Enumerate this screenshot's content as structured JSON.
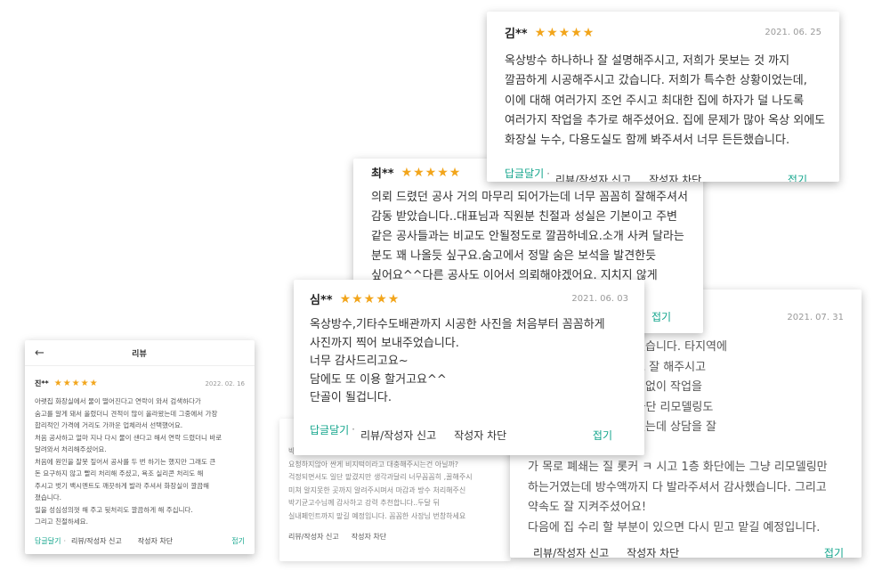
{
  "panel": {
    "title": "리뷰",
    "back_icon": "arrow-left-icon",
    "review": {
      "author": "진**",
      "stars": "★★★★★",
      "date": "2022. 02. 16",
      "lines": [
        "아랫집 화장실에서 물이 떨어진다고 연락이 와서 검색하다가",
        "숨고를 알게 돼서 올렸더니 견적이 많이 올라왔는데 그중에서 가장",
        "합리적인 가격에 거리도 가까운 업체라서 선택했어요.",
        "처음 공사하고 얼마 지나 다시 물이 샌다고 해서 연락 드렸더니 바로",
        "달려와서 처리해주셨어요.",
        "처음에 원인을 잘못 짚어서 공사를 두 번 하기는 했지만 그래도 큰",
        "돈 요구하지 않고 빨리 처리해 주셨고, 욕조 실리콘 처리도 해",
        "주시고 벗기 백시멘트도 깨끗하게 발라 주셔서 화장실이 깔끔해",
        "졌습니다.",
        "일을 성심성의껏 해 주고 뒷처리도 깔끔하게 해 주십니다.",
        "그리고 친절하세요."
      ],
      "reply": "답글달기",
      "report": "리뷰/작성자 신고",
      "block": "작성자 차단",
      "fold": "접기"
    }
  },
  "faded_card": {
    "lines": [
      "박기균고수님께 견적상담을 하였고 생각보다 꼼꼼하게 많이",
      "요청하지않아 싼게 비지떡이라고 대충해주시는건 아닐까?",
      "걱정되면서도 일단 맡겼지만  생각과달리 너무꼼꼼히 ,꿀해주시",
      "미쳐 알지못한 곳까지 알려주시며서 마감과 방수 처리해주신",
      "박기균고수님께 감사하고 강력 추천합니다..두달 뒤",
      "실내페인트까지 맡길 예정입니다. 꼼꼼한 사장님 번창하세요"
    ],
    "report": "리뷰/작성자 신고",
    "block": "작성자 차단"
  },
  "card_0731": {
    "date": "2021. 07. 31",
    "lines": [
      "                    에서 옥상방수를 하게 됐습니다. 타지역에",
      "                 는 부분은 여러번 설명도 잘 해주시고",
      "                    상을 잘 알려주셔서 걱정없이 작업을",
      "                 옥상 방수 말고도 1층 화단 리모델링도",
      "                    향도 정하지 않은 상태였는데 상담을 잘",
      "",
      "   가 목로 폐쇄는 질 롯커 ㅋ 시고 1층 화단에는 그냥 리모델링만",
      "  하는거였는데 방수액까지 다 발라주셔서 감사했습니다. 그리고",
      "  약속도 잘 지켜주셨어요!",
      "  다음에 집 수리 할 부분이 있으면 다시 믿고 맡길 예정입니다."
    ],
    "report": "리뷰/작성자 신고",
    "block": "작성자 차단",
    "fold": "접기"
  },
  "card_choi": {
    "author": "최**",
    "stars": "★★★★★",
    "lines": [
      "의뢰 드렸던 공사 거의 마무리 되어가는데 너무 꼼꼼히 잘해주셔서",
      "감동 받았습니다..대표님과 직원분 친절과 성실은 기본이고 주변",
      "같은 공사들과는 비교도 안될정도로 깔끔하네요.소개 사켜 달라는",
      "분도 꽤 나올듯 싶구요.숨고에서 정말 숨은 보석을 발견한듯",
      "싶어요^^다른 공사도 이어서 의뢰해야겠어요. 지치지 않게"
    ]
  },
  "card_kim": {
    "author": "김**",
    "stars": "★★★★★",
    "date": "2021. 06. 25",
    "lines": [
      "옥상방수 하나하나 잘 설명해주시고, 저희가 못보는 것 까지",
      "깔끔하게 시공해주시고 갔습니다. 저희가 특수한 상황이었는데,",
      "이에 대해 여러가지 조언 주시고 최대한 집에 하자가 덜 나도록",
      "여러가지 작업을 추가로 해주셨어요. 집에 문제가 많아 옥상 외에도",
      "화장실 누수, 다용도실도 함께 봐주셔서 너무 든든했습니다."
    ],
    "reply": "답글달기",
    "report": "리뷰/작성자 신고",
    "block": "작성자 차단",
    "fold": "접기"
  },
  "card_sim": {
    "author": "심**",
    "stars": "★★★★★",
    "date": "2021. 06. 03",
    "lines": [
      "옥상방수,기타수도배관까지 시공한 사진을 처음부터 꼼꼼하게",
      "사진까지 찍어 보내주었습니다.",
      "너무 감사드리고요~",
      "담에도 또 이용 할거고요^^",
      "단골이 될겁니다."
    ],
    "reply": "답글달기",
    "report": "리뷰/작성자 신고",
    "block": "작성자 차단",
    "fold": "접기",
    "peek_fold": "접기"
  },
  "colors": {
    "star": "#f2a51b",
    "accent": "#13a58c"
  }
}
